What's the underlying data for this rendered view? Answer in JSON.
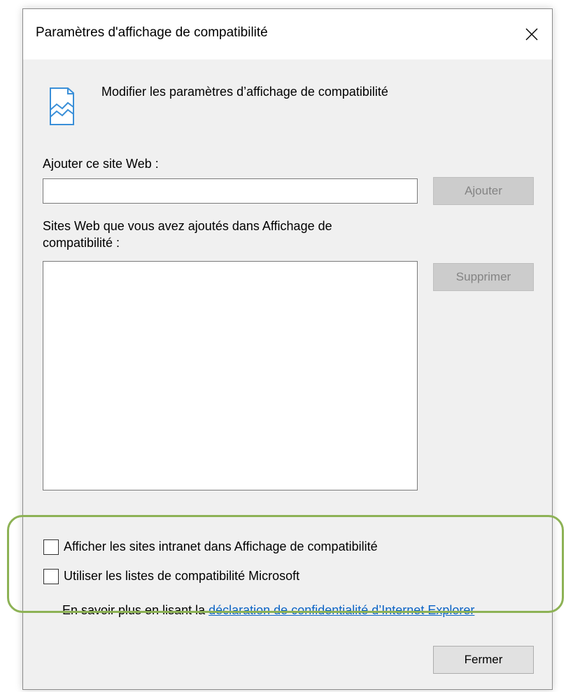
{
  "window": {
    "title": "Paramètres d'affichage de compatibilité",
    "close_icon": "close-icon"
  },
  "header": {
    "icon": "compatibility-view-icon",
    "text": "Modifier les paramètres d’affichage de compatibilité"
  },
  "add_site": {
    "label": "Ajouter ce site Web :",
    "value": "",
    "button_label": "Ajouter"
  },
  "site_list": {
    "label_line1": "Sites Web que vous avez ajoutés dans Affichage de",
    "label_line2": "compatibilité :",
    "items": [],
    "remove_button_label": "Supprimer"
  },
  "options": {
    "intranet_label": "Afficher les sites intranet dans Affichage de compatibilité",
    "intranet_checked": false,
    "microsoft_lists_label": "Utiliser les listes de compatibilité Microsoft",
    "microsoft_lists_checked": false
  },
  "info": {
    "prefix": "En savoir plus en lisant la ",
    "link_text": "déclaration de confidentialité d’Internet Explorer"
  },
  "footer": {
    "close_button_label": "Fermer"
  },
  "colors": {
    "link": "#0b63c5",
    "highlight_border": "#8db255",
    "dialog_background": "#f0f0f0",
    "disabled_button": "#cccccc"
  }
}
